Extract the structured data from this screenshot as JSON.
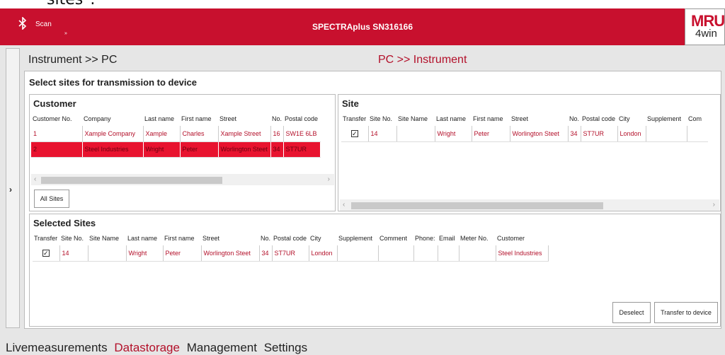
{
  "top_cut_text": "sites\".",
  "titlebar": {
    "scan_label": "Scan",
    "chevron": "»",
    "title": "SPECTRAplus SN316166",
    "logo_main": "MRU",
    "logo_sub": "4win"
  },
  "side_arrow": "›",
  "nav": {
    "left": "Instrument >> PC",
    "right": "PC >> Instrument"
  },
  "main_title": "Select sites for transmission to device",
  "customer": {
    "title": "Customer",
    "headers": [
      "Customer No.",
      "Company",
      "Last name",
      "First name",
      "Street",
      "No.",
      "Postal code"
    ],
    "rows": [
      [
        "1",
        "Xample Company",
        "Xample",
        "Charles",
        "Xample Street",
        "16",
        "SW1E 6LB"
      ],
      [
        "2",
        "Steel Industries",
        "Wright",
        "Peter",
        "Worlington Steet",
        "34",
        "ST7UR"
      ]
    ],
    "all_sites_label": "All Sites"
  },
  "site": {
    "title": "Site",
    "headers": [
      "Transfer",
      "Site No.",
      "Site Name",
      "Last name",
      "First name",
      "Street",
      "No.",
      "Postal code",
      "City",
      "Supplement",
      "Com"
    ],
    "rows": [
      [
        "✓",
        "14",
        "",
        "Wright",
        "Peter",
        "Worlington Steet",
        "34",
        "ST7UR",
        "London",
        "",
        ""
      ]
    ]
  },
  "selected": {
    "title": "Selected Sites",
    "headers": [
      "Transfer",
      "Site No.",
      "Site Name",
      "Last name",
      "First name",
      "Street",
      "No.",
      "Postal code",
      "City",
      "Supplement",
      "Comment",
      "Phone:",
      "Email",
      "Meter No.",
      "Customer"
    ],
    "rows": [
      [
        "✓",
        "14",
        "",
        "Wright",
        "Peter",
        "Worlington Steet",
        "34",
        "ST7UR",
        "London",
        "",
        "",
        "",
        "",
        "",
        "Steel Industries"
      ]
    ],
    "deselect_label": "Deselect",
    "transfer_label": "Transfer to device"
  },
  "menu": [
    "Livemeasurements",
    "Datastorage",
    "Management",
    "Settings"
  ],
  "colors": {
    "brand": "#c8102e",
    "accent_text": "#b3102a",
    "selected_row": "#e8132f"
  },
  "icons": {
    "bluetooth": "bluetooth-icon",
    "scroll_left": "‹",
    "scroll_right": "›"
  }
}
